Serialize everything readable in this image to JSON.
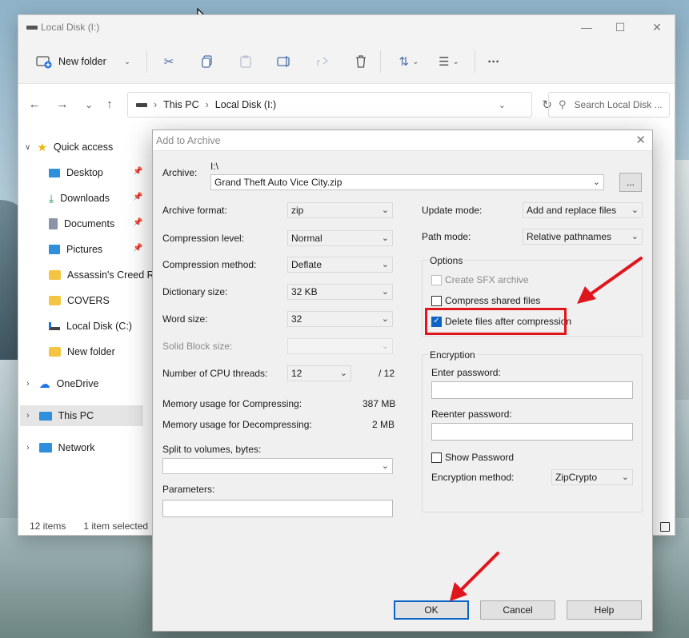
{
  "explorer": {
    "title": "Local Disk (I:)",
    "window_controls": {
      "minimize": "—",
      "maximize": "☐",
      "close": "✕"
    },
    "toolbar": {
      "new_folder": "New folder"
    },
    "address": {
      "path": [
        "This PC",
        "Local Disk (I:)"
      ]
    },
    "search_placeholder": "Search Local Disk ...",
    "sidebar": {
      "quick_access": "Quick access",
      "items": [
        "Desktop",
        "Downloads",
        "Documents",
        "Pictures",
        "Assassin's Creed  R",
        "COVERS",
        "Local Disk (C:)",
        "New folder"
      ],
      "onedrive": "OneDrive",
      "this_pc": "This PC",
      "network": "Network"
    },
    "status": {
      "count": "12 items",
      "selected": "1 item selected"
    }
  },
  "dialog": {
    "title": "Add to Archive",
    "archive_label": "Archive:",
    "archive_path": "I:\\",
    "archive_name": "Grand Theft Auto Vice City.zip",
    "browse": "...",
    "left": {
      "archive_format": {
        "label": "Archive format:",
        "value": "zip"
      },
      "compression_level": {
        "label": "Compression level:",
        "value": "Normal"
      },
      "compression_method": {
        "label": "Compression method:",
        "value": "Deflate"
      },
      "dictionary_size": {
        "label": "Dictionary size:",
        "value": "32 KB"
      },
      "word_size": {
        "label": "Word size:",
        "value": "32"
      },
      "solid_block": {
        "label": "Solid Block size:",
        "value": ""
      },
      "cpu_threads": {
        "label": "Number of CPU threads:",
        "value": "12",
        "max": "/ 12"
      },
      "mem_compress": {
        "label": "Memory usage for Compressing:",
        "value": "387 MB"
      },
      "mem_decompress": {
        "label": "Memory usage for Decompressing:",
        "value": "2 MB"
      },
      "split_label": "Split to volumes, bytes:",
      "parameters_label": "Parameters:"
    },
    "right": {
      "update_mode": {
        "label": "Update mode:",
        "value": "Add and replace files"
      },
      "path_mode": {
        "label": "Path mode:",
        "value": "Relative pathnames"
      },
      "options_title": "Options",
      "create_sfx": "Create SFX archive",
      "compress_shared": "Compress shared files",
      "delete_after": "Delete files after compression",
      "encryption_title": "Encryption",
      "enter_password": "Enter password:",
      "reenter_password": "Reenter password:",
      "show_password": "Show Password",
      "encryption_method": {
        "label": "Encryption method:",
        "value": "ZipCrypto"
      }
    },
    "buttons": {
      "ok": "OK",
      "cancel": "Cancel",
      "help": "Help"
    }
  },
  "colors": {
    "accent": "#0a63c5",
    "annotation": "#e1161c"
  }
}
